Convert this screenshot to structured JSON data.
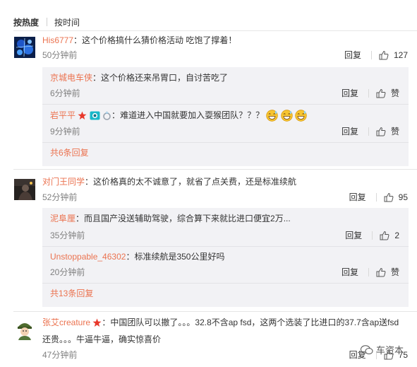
{
  "sort": {
    "hot_label": "按热度",
    "time_label": "按时间"
  },
  "comments": [
    {
      "user": "His6777",
      "sep": "：",
      "text": "这个价格搞什么猜价格活动 吃饱了撑着！",
      "time": "50分钟前",
      "reply_label": "回复",
      "likes": "127",
      "replies": [
        {
          "user": "京城电车侠",
          "sep": "：",
          "text": "这个价格还来吊胃口，自讨苦吃了",
          "time": "6分钟前",
          "reply_label": "回复",
          "like_label": "赞"
        },
        {
          "user": "岩平平",
          "sep": "：",
          "text": "难道进入中国就要加入耍猴团队？？？",
          "time": "9分钟前",
          "reply_label": "回复",
          "like_label": "赞"
        }
      ],
      "more_label": "共6条回复"
    },
    {
      "user": "对门王同学",
      "sep": "：",
      "text": "这价格真的太不诚意了，就省了点关费，还是标准续航",
      "time": "52分钟前",
      "reply_label": "回复",
      "likes": "95",
      "replies": [
        {
          "user": "泥阜厘",
          "sep": "：",
          "text": "而且国产没送辅助驾驶，综合算下来就比进口便宜2万...",
          "time": "35分钟前",
          "reply_label": "回复",
          "likes": "2"
        },
        {
          "user": "Unstoppable_46302",
          "sep": "：",
          "text": "标准续航是350公里好吗",
          "time": "20分钟前",
          "reply_label": "回复",
          "like_label": "赞"
        }
      ],
      "more_label": "共13条回复"
    },
    {
      "user": "张艾creature",
      "sep": "：",
      "text": "中国团队可以撤了。。。32.8不含ap fsd，这两个选装了比进口的37.7含ap送fsd",
      "text2": "还贵。。。牛逼牛逼，确实惊喜价",
      "time": "47分钟前",
      "reply_label": "回复",
      "likes": "75"
    }
  ],
  "watermark": "车资本",
  "colors": {
    "username": "#eb7350",
    "reply_bg": "#f2f2f5",
    "time": "#808080"
  }
}
